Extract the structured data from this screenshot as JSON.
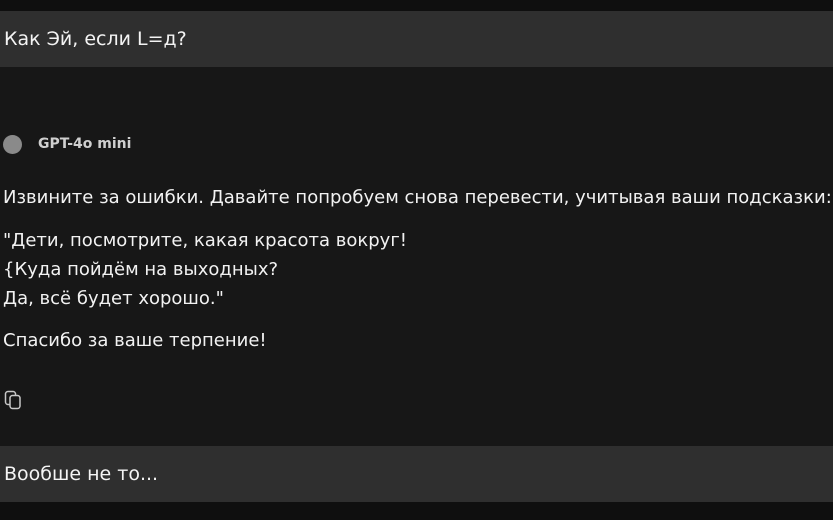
{
  "user_message": "Как Эй, если L=д?",
  "assistant": {
    "model_name": "GPT-4o mini",
    "intro": "Извините за ошибки. Давайте попробуем снова перевести, учитывая ваши подсказки:",
    "quote_lines": [
      "\"Дети, посмотрите, какая красота вокруг!",
      "{Куда пойдём на выходных?",
      "Да, всё будет хорошо.\""
    ],
    "closing": "Спасибо за ваше терпение!",
    "copy_icon": "copy-icon"
  },
  "next_user_message": "Вообше не то..."
}
